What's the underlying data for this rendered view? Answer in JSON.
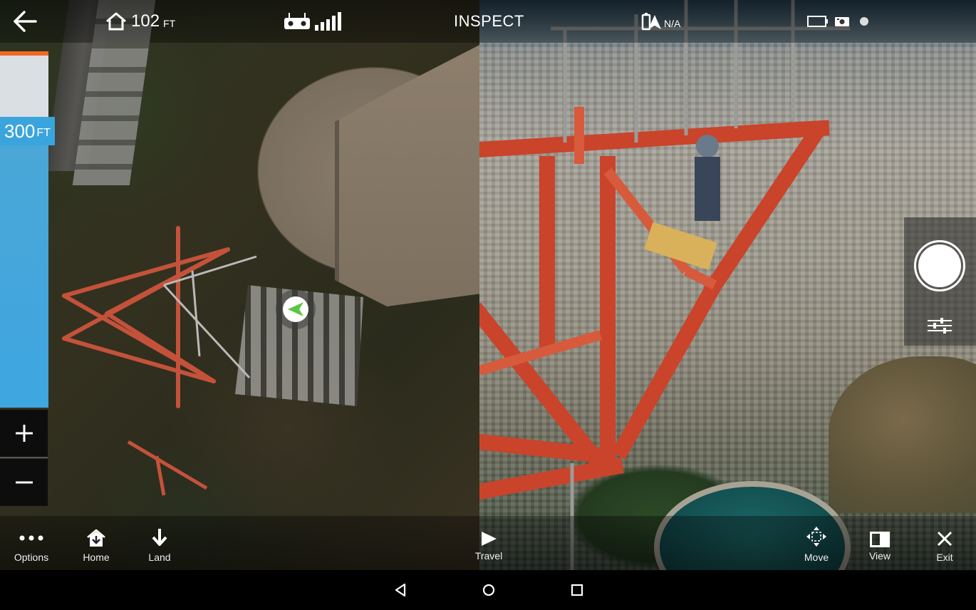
{
  "top_bar": {
    "home_altitude_value": "102",
    "home_altitude_unit": "FT",
    "mode_title": "INSPECT",
    "gps_status": "N/A"
  },
  "map": {
    "altitude_setting_value": "300",
    "altitude_setting_unit": "FT"
  },
  "bottom_bar": {
    "options_label": "Options",
    "home_label": "Home",
    "land_label": "Land",
    "travel_label": "Travel",
    "move_label": "Move",
    "view_label": "View",
    "exit_label": "Exit"
  },
  "icons": {
    "back": "arrow-left-icon",
    "home": "home-icon",
    "remote_controller": "remote-controller-icon",
    "signal": "signal-bars-icon",
    "gps": "gps-icon",
    "battery": "battery-icon",
    "camera": "camera-icon",
    "recording_dot": "status-dot-icon",
    "zoom_in": "plus-icon",
    "zoom_out": "minus-icon",
    "drone": "drone-arrow-icon",
    "shutter": "shutter-icon",
    "camera_settings": "sliders-icon"
  },
  "colors": {
    "accent_orange": "#f26a21",
    "altitude_blue": "#3aa5dc",
    "drone_green": "#5cc544"
  }
}
